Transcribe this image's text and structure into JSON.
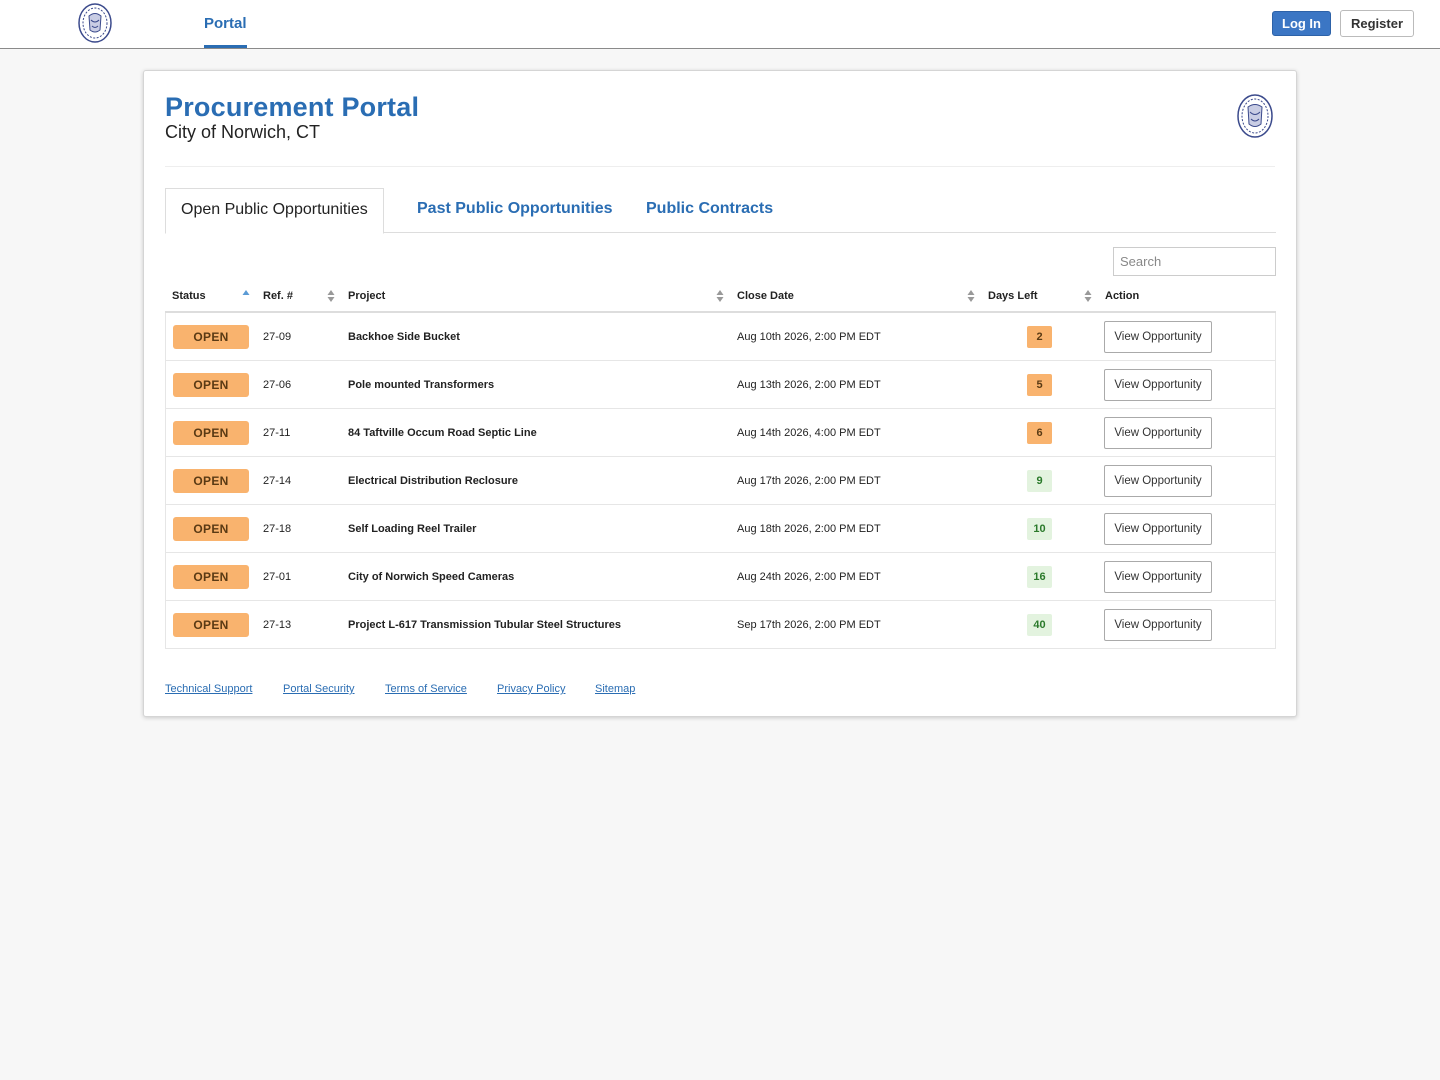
{
  "nav": {
    "portal_tab": "Portal",
    "login_label": "Log In",
    "register_label": "Register"
  },
  "header": {
    "title": "Procurement Portal",
    "subtitle": "City of Norwich, CT"
  },
  "tabs": [
    {
      "label": "Open Public Opportunities",
      "active": true
    },
    {
      "label": "Past Public Opportunities",
      "active": false
    },
    {
      "label": "Public Contracts",
      "active": false
    }
  ],
  "search": {
    "placeholder": "Search",
    "value": ""
  },
  "table": {
    "columns": [
      {
        "label": "Status",
        "sort": "ascending"
      },
      {
        "label": "Ref. #",
        "sort": "none"
      },
      {
        "label": "Project",
        "sort": "none"
      },
      {
        "label": "Close Date",
        "sort": "none"
      },
      {
        "label": "Days Left",
        "sort": "none"
      },
      {
        "label": "Action",
        "sort": "none"
      }
    ],
    "rows": [
      {
        "status": "OPEN",
        "ref": "27-09",
        "project": "Backhoe Side Bucket",
        "close_date": "Aug 10th 2026, 2:00 PM EDT",
        "days_left": "2",
        "action": "View Opportunity"
      },
      {
        "status": "OPEN",
        "ref": "27-06",
        "project": "Pole mounted Transformers",
        "close_date": "Aug 13th 2026, 2:00 PM EDT",
        "days_left": "5",
        "action": "View Opportunity"
      },
      {
        "status": "OPEN",
        "ref": "27-11",
        "project": "84 Taftville Occum Road Septic Line",
        "close_date": "Aug 14th 2026, 4:00 PM EDT",
        "days_left": "6",
        "action": "View Opportunity"
      },
      {
        "status": "OPEN",
        "ref": "27-14",
        "project": "Electrical Distribution Reclosure",
        "close_date": "Aug 17th 2026, 2:00 PM EDT",
        "days_left": "9",
        "action": "View Opportunity"
      },
      {
        "status": "OPEN",
        "ref": "27-18",
        "project": "Self Loading Reel Trailer",
        "close_date": "Aug 18th 2026, 2:00 PM EDT",
        "days_left": "10",
        "action": "View Opportunity"
      },
      {
        "status": "OPEN",
        "ref": "27-01",
        "project": "City of Norwich Speed Cameras",
        "close_date": "Aug 24th 2026, 2:00 PM EDT",
        "days_left": "16",
        "action": "View Opportunity"
      },
      {
        "status": "OPEN",
        "ref": "27-13",
        "project": "Project L-617 Transmission Tubular Steel Structures",
        "close_date": "Sep 17th 2026, 2:00 PM EDT",
        "days_left": "40",
        "action": "View Opportunity"
      }
    ]
  },
  "footer": {
    "links": [
      "Technical Support",
      "Portal Security",
      "Terms of Service",
      "Privacy Policy",
      "Sitemap"
    ]
  },
  "colors": {
    "brand_blue": "#2a6db3",
    "open_badge": "#f9b36e",
    "days_warn": "#f9b36e",
    "days_ok": "#e3f3df",
    "days_ok_text": "#2b7a2b"
  },
  "icons": {
    "seal": "city-seal-icon",
    "sort_asc": "sort-ascending-icon",
    "sort_both": "sort-both-icon"
  }
}
